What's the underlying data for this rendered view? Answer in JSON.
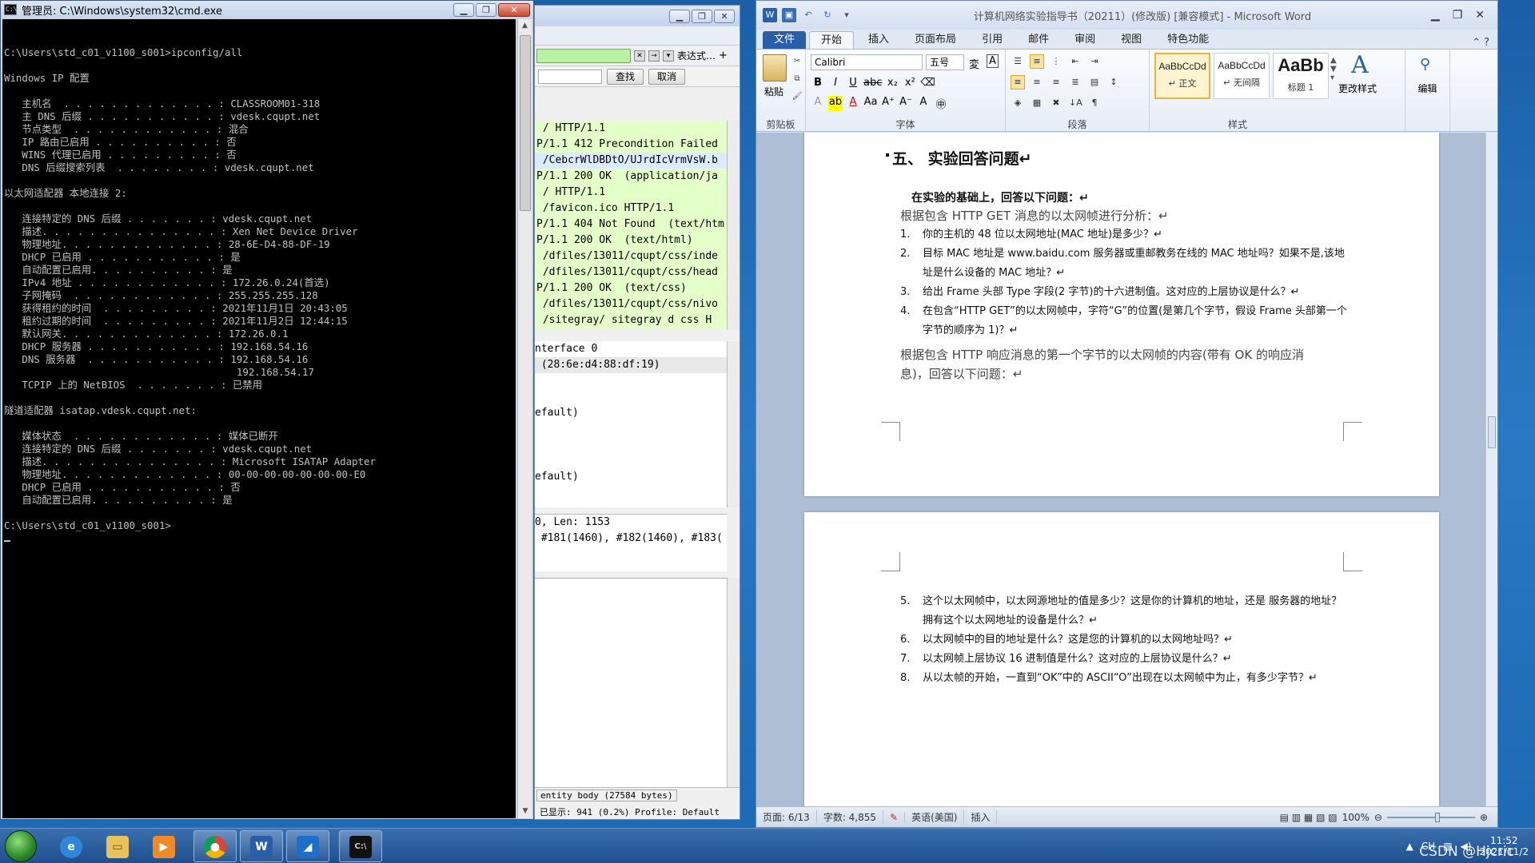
{
  "cmd": {
    "title": "管理员: C:\\Windows\\system32\\cmd.exe",
    "lines": [
      "",
      "C:\\Users\\std_c01_v1100_s001>ipconfig/all",
      "",
      "Windows IP 配置",
      "",
      "   主机名  . . . . . . . . . . . . . : CLASSROOM01-318",
      "   主 DNS 后缀 . . . . . . . . . . . : vdesk.cqupt.net",
      "   节点类型  . . . . . . . . . . . . : 混合",
      "   IP 路由已启用 . . . . . . . . . . : 否",
      "   WINS 代理已启用 . . . . . . . . . : 否",
      "   DNS 后缀搜索列表  . . . . . . . . : vdesk.cqupt.net",
      "",
      "以太网适配器 本地连接 2:",
      "",
      "   连接特定的 DNS 后缀 . . . . . . . : vdesk.cqupt.net",
      "   描述. . . . . . . . . . . . . . . : Xen Net Device Driver",
      "   物理地址. . . . . . . . . . . . . : 28-6E-D4-88-DF-19",
      "   DHCP 已启用 . . . . . . . . . . . : 是",
      "   自动配置已启用. . . . . . . . . . : 是",
      "   IPv4 地址 . . . . . . . . . . . . : 172.26.0.24(首选)",
      "   子网掩码  . . . . . . . . . . . . : 255.255.255.128",
      "   获得租约的时间  . . . . . . . . . : 2021年11月1日 20:43:05",
      "   租约过期的时间  . . . . . . . . . : 2021年11月2日 12:44:15",
      "   默认网关. . . . . . . . . . . . . : 172.26.0.1",
      "   DHCP 服务器 . . . . . . . . . . . : 192.168.54.16",
      "   DNS 服务器  . . . . . . . . . . . : 192.168.54.16",
      "                                       192.168.54.17",
      "   TCPIP 上的 NetBIOS  . . . . . . . : 已禁用",
      "",
      "隧道适配器 isatap.vdesk.cqupt.net:",
      "",
      "   媒体状态  . . . . . . . . . . . . : 媒体已断开",
      "   连接特定的 DNS 后缀 . . . . . . . : vdesk.cqupt.net",
      "   描述. . . . . . . . . . . . . . . : Microsoft ISATAP Adapter",
      "   物理地址. . . . . . . . . . . . . : 00-00-00-00-00-00-00-E0",
      "   DHCP 已启用 . . . . . . . . . . . : 否",
      "   自动配置已启用. . . . . . . . . . : 是",
      "",
      "C:\\Users\\std_c01_v1100_s001>"
    ]
  },
  "wireshark": {
    "filter_expr_label": "表达式…",
    "find_label": "查找",
    "cancel_label": "取消",
    "packet_rows": [
      " / HTTP/1.1",
      "P/1.1 412 Precondition Failed",
      " /CebcrWlDBDtO/UJrdIcVrmVsW.b",
      "P/1.1 200 OK  (application/ja",
      " / HTTP/1.1",
      " /favicon.ico HTTP/1.1",
      "P/1.1 404 Not Found  (text/htm",
      "P/1.1 200 OK  (text/html)",
      " /dfiles/13011/cqupt/css/inde",
      " /dfiles/13011/cqupt/css/head",
      "P/1.1 200 OK  (text/css)",
      " /dfiles/13011/cqupt/css/nivo",
      " /sitegray/ sitegray d css H"
    ],
    "detail_rows": [
      "nterface 0",
      " (28:6e:d4:88:df:19)",
      "",
      "",
      "efault)",
      "",
      "",
      "",
      "efault)"
    ],
    "detail2_rows": [
      "0, Len: 1153",
      " #181(1460), #182(1460), #183("
    ],
    "status_entity": "entity body (27584 bytes)",
    "status_shown": "已显示: 941 (0.2%)  Profile: Default"
  },
  "word": {
    "title": "计算机网络实验指导书（20211）(修改版) [兼容模式] - Microsoft Word",
    "tabs": [
      "文件",
      "开始",
      "插入",
      "页面布局",
      "引用",
      "邮件",
      "审阅",
      "视图",
      "特色功能"
    ],
    "ribbon": {
      "paste": "粘贴",
      "clipboard": "剪贴板",
      "font_name": "Calibri",
      "font_size": "五号",
      "font_group": "字体",
      "para_group": "段落",
      "styles_group": "样式",
      "styles": [
        {
          "preview": "AaBbCcDd",
          "name": "↵ 正文"
        },
        {
          "preview": "AaBbCcDd",
          "name": "↵ 无间隔"
        },
        {
          "preview": "AaBb",
          "name": "标题 1"
        }
      ],
      "change_styles": "更改样式",
      "edit": "编辑"
    },
    "doc": {
      "heading": "五、   实验回答问题↵",
      "intro": "在实验的基础上，回答以下问题：↵",
      "sub1": "根据包含  HTTP GET 消息的以太网帧进行分析：↵",
      "items1": [
        {
          "n": "1.",
          "text": "你的主机的 48 位以太网地址(MAC 地址)是多少？↵"
        },
        {
          "n": "2.",
          "text": "目标 MAC 地址是 www.baidu.com 服务器或重邮教务在线的 MAC 地址吗？如果不是,该地址是什么设备的 MAC 地址？↵"
        },
        {
          "n": "3.",
          "text": " 给出 Frame 头部 Type 字段(2 字节)的十六进制值。这对应的上层协议是什么？↵"
        },
        {
          "n": "4.",
          "text": " 在包含“HTTP GET”的以太网帧中，字符“G”的位置(是第几个字节，假设 Frame 头部第一个字节的顺序为 1)？↵"
        }
      ],
      "sub2_line1": "根据包含  HTTP 响应消息的第一个字节的以太网帧的内容(带有 OK 的响应消",
      "sub2_line2": "息)，回答以下问题：↵",
      "items2": [
        {
          "n": "5.",
          "text": "这个以太网帧中，以太网源地址的值是多少？这是你的计算机的地址，还是  服务器的地址？拥有这个以太网地址的设备是什么？↵"
        },
        {
          "n": "6.",
          "text": "以太网帧中的目的地址是什么？这是您的计算机的以太网地址吗？↵"
        },
        {
          "n": "7.",
          "text": "以太网帧上层协议 16 进制值是什么？这对应的上层协议是什么？↵"
        },
        {
          "n": "8.",
          "text": "从以太帧的开始，一直到“OK”中的  ASCII“O”出现在以太网帧中为止，有多少字节？↵"
        }
      ]
    },
    "status": {
      "page": "页面: 6/13",
      "words": "字数: 4,855",
      "lang": "英语(美国)",
      "insert": "插入",
      "zoom": "100%"
    }
  },
  "taskbar": {
    "apps": [
      "windows-start",
      "internet-explorer",
      "file-explorer",
      "media-player",
      "chrome",
      "word",
      "wireshark",
      "cmd"
    ],
    "ime": "CH",
    "time": "11:52",
    "date": "2021/11/2",
    "watermark": "CSDN @Hjcric"
  }
}
